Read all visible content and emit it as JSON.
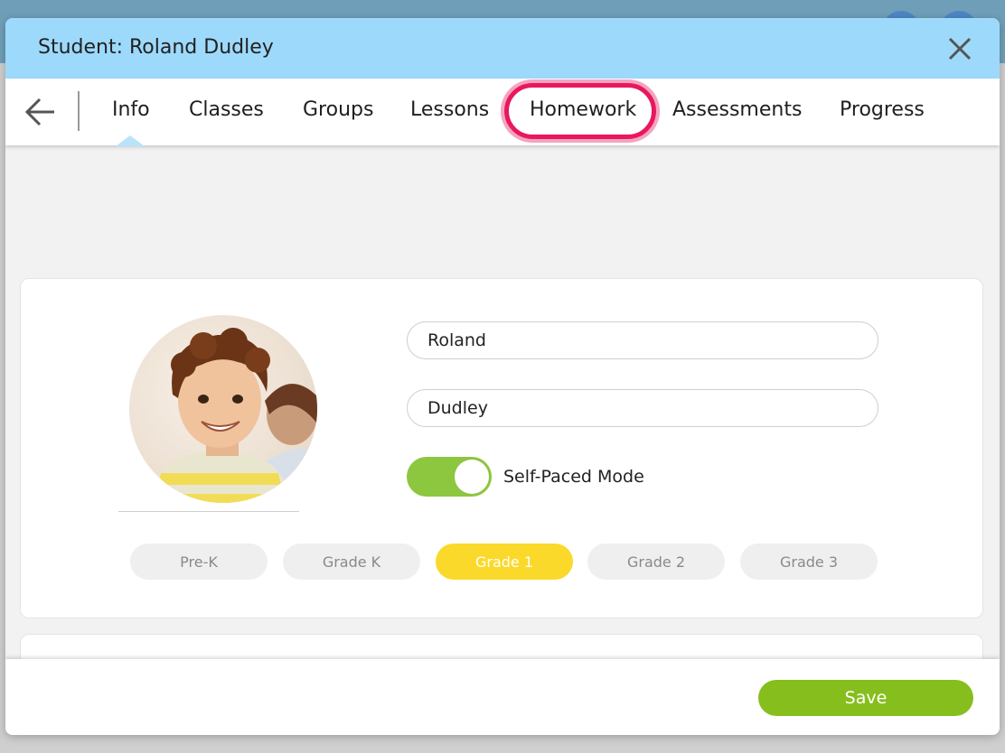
{
  "header": {
    "title": "Student: Roland Dudley",
    "close_icon": "close-icon"
  },
  "tabs": {
    "back_icon": "arrow-left-icon",
    "items": [
      {
        "label": "Info",
        "active": true
      },
      {
        "label": "Classes"
      },
      {
        "label": "Groups"
      },
      {
        "label": "Lessons"
      },
      {
        "label": "Homework",
        "highlighted": true
      },
      {
        "label": "Assessments"
      },
      {
        "label": "Progress"
      }
    ]
  },
  "profile": {
    "avatar": "student-photo",
    "first_name": "Roland",
    "last_name": "Dudley",
    "self_paced": {
      "label": "Self-Paced Mode",
      "on": true
    }
  },
  "grades": {
    "items": [
      "Pre-K",
      "Grade K",
      "Grade 1",
      "Grade 2",
      "Grade 3"
    ],
    "selected": "Grade 1"
  },
  "footer": {
    "save_label": "Save"
  },
  "colors": {
    "header_bg": "#9dd9fb",
    "highlight_ring": "#e8185c",
    "toggle_on": "#8dc63f",
    "grade_selected": "#fbd92a",
    "save_button": "#86bf1d"
  }
}
